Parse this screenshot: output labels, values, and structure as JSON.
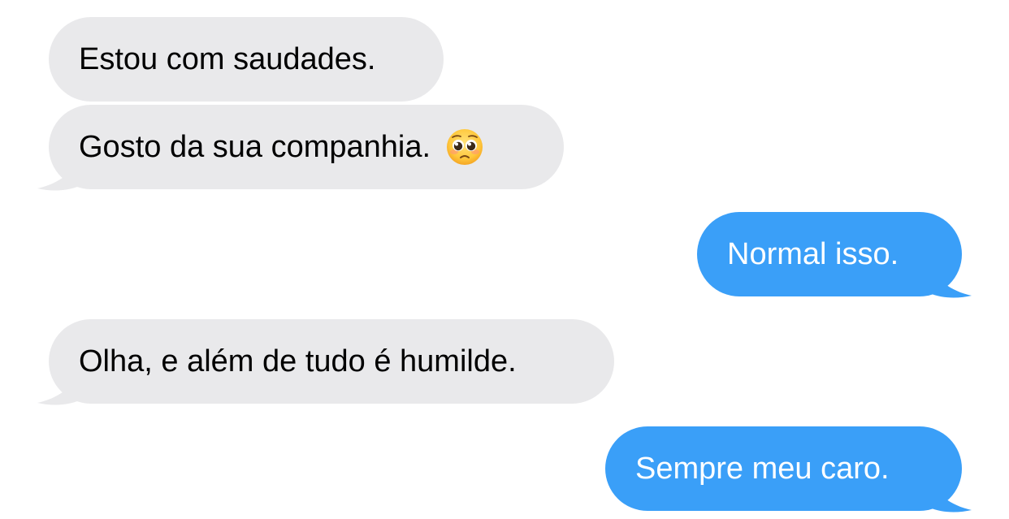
{
  "conversation": {
    "messages": [
      {
        "sender": "other",
        "text": "Estou com saudades."
      },
      {
        "sender": "other",
        "text": "Gosto da sua companhia.",
        "emoji": "pleading-face-icon"
      },
      {
        "sender": "me",
        "text": "Normal isso."
      },
      {
        "sender": "other",
        "text": "Olha, e além de tudo é humilde."
      },
      {
        "sender": "me",
        "text": "Sempre meu caro."
      }
    ]
  },
  "colors": {
    "received_bubble": "#e9e9eb",
    "sent_bubble": "#3a9ff8",
    "received_text": "#000000",
    "sent_text": "#ffffff"
  }
}
